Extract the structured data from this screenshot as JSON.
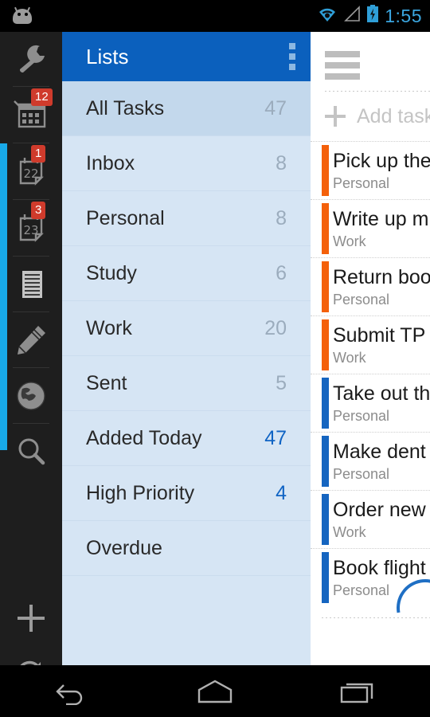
{
  "statusbar": {
    "robot_icon": "android-robot-icon",
    "wifi_icon": "wifi-icon",
    "signal_icon": "signal-icon",
    "battery_icon": "battery-charging-icon",
    "time": "1:55"
  },
  "rail": {
    "items": [
      {
        "icon": "wrench-icon",
        "badge": null
      },
      {
        "icon": "calendar-grid-icon",
        "badge": "12"
      },
      {
        "icon": "calendar-22-icon",
        "badge": "1",
        "day": "22"
      },
      {
        "icon": "calendar-23-icon",
        "badge": "3",
        "day": "23"
      },
      {
        "icon": "list-lines-icon",
        "badge": null,
        "active": true
      },
      {
        "icon": "pencil-icon",
        "badge": null
      },
      {
        "icon": "globe-icon",
        "badge": null
      },
      {
        "icon": "search-icon",
        "badge": null
      }
    ],
    "bottom_items": [
      {
        "icon": "plus-icon"
      },
      {
        "icon": "refresh-sync-icon"
      }
    ]
  },
  "lists": {
    "header": {
      "title": "Lists",
      "overflow_icon": "overflow-menu-icon"
    },
    "rows": [
      {
        "label": "All Tasks",
        "count": "47",
        "selected": true,
        "accent": false
      },
      {
        "label": "Inbox",
        "count": "8",
        "selected": false,
        "accent": false
      },
      {
        "label": "Personal",
        "count": "8",
        "selected": false,
        "accent": false
      },
      {
        "label": "Study",
        "count": "6",
        "selected": false,
        "accent": false
      },
      {
        "label": "Work",
        "count": "20",
        "selected": false,
        "accent": false
      },
      {
        "label": "Sent",
        "count": "5",
        "selected": false,
        "accent": false
      },
      {
        "label": "Added Today",
        "count": "47",
        "selected": false,
        "accent": true
      },
      {
        "label": "High Priority",
        "count": "4",
        "selected": false,
        "accent": true
      },
      {
        "label": "Overdue",
        "count": "",
        "selected": false,
        "accent": false
      }
    ]
  },
  "tasks": {
    "menu_icon": "hamburger-menu-icon",
    "add_task_label": "Add task",
    "add_task_icon": "plus-icon",
    "items": [
      {
        "title": "Pick up the",
        "list": "Personal",
        "priority_color": "#f4600a"
      },
      {
        "title": "Write up m",
        "list": "Work",
        "priority_color": "#f4600a"
      },
      {
        "title": "Return boo",
        "list": "Personal",
        "priority_color": "#f4600a"
      },
      {
        "title": "Submit TP",
        "list": "Work",
        "priority_color": "#f4600a"
      },
      {
        "title": "Take out th",
        "list": "Personal",
        "priority_color": "#1565c0"
      },
      {
        "title": "Make dent",
        "list": "Personal",
        "priority_color": "#1565c0"
      },
      {
        "title": "Order new",
        "list": "Work",
        "priority_color": "#1565c0"
      },
      {
        "title": "Book flight",
        "list": "Personal",
        "priority_color": "#1565c0"
      }
    ]
  },
  "navbar": {
    "back_icon": "back-arrow-icon",
    "home_icon": "home-icon",
    "recents_icon": "recent-apps-icon"
  },
  "colors": {
    "header_blue": "#0b60bd",
    "rail_dark": "#1e1e1e",
    "active_strip": "#18a9e8",
    "panel_blue": "#d6e5f4",
    "selected_blue": "#c3d8ec",
    "accent_count": "#1064c4",
    "badge_red": "#cf3b2c",
    "priority_high": "#f4600a",
    "priority_normal": "#1565c0",
    "status_time": "#3ba6e0"
  }
}
